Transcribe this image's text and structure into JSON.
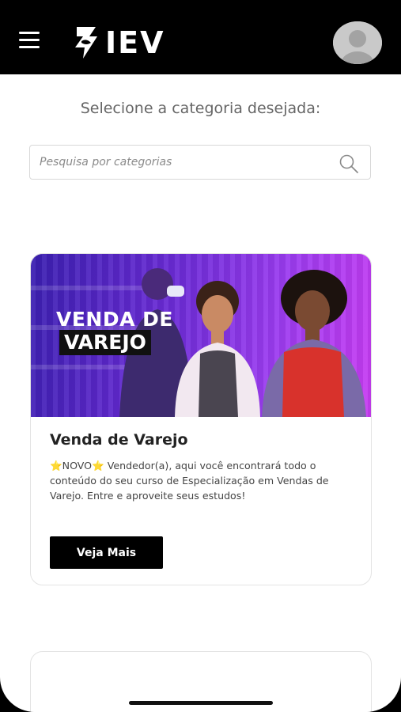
{
  "header": {
    "brand": "IEV",
    "menu_icon": "hamburger-menu-icon",
    "avatar_icon": "user-avatar-icon"
  },
  "main": {
    "heading": "Selecione a categoria desejada:",
    "search": {
      "placeholder": "Pesquisa por categorias",
      "value": "",
      "icon": "search-icon"
    },
    "cards": [
      {
        "banner_line1": "VENDA DE",
        "banner_line2": "VAREJO",
        "title": "Venda de Varejo",
        "description": "⭐NOVO⭐ Vendedor(a), aqui você encontrará todo o conteúdo do seu curso de Especialização em Vendas de Varejo. Entre e aproveite seus estudos!",
        "button_label": "Veja Mais"
      }
    ]
  },
  "colors": {
    "header_bg": "#000000",
    "banner_purple": "#7b2ee0",
    "banner_magenta": "#c83cf2",
    "button_bg": "#000000"
  }
}
